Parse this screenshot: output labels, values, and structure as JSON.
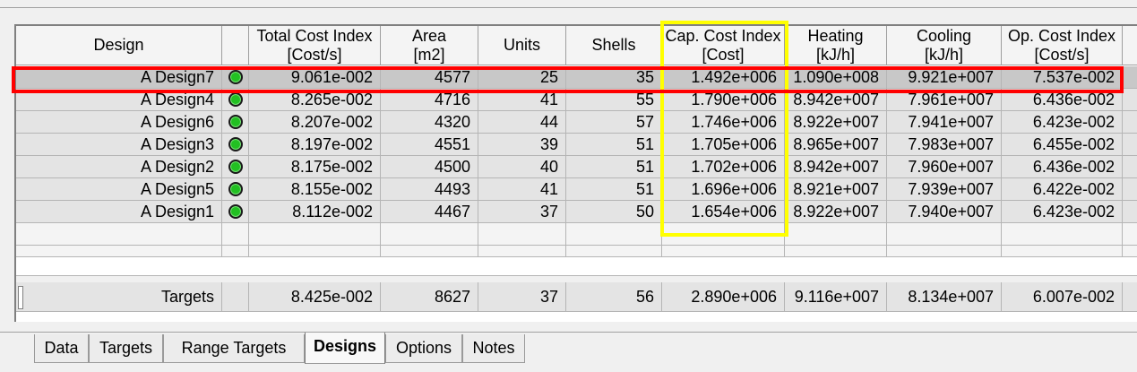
{
  "grid": {
    "headers": [
      {
        "line1": "Design",
        "line2": ""
      },
      {
        "line1": "",
        "line2": ""
      },
      {
        "line1": "Total Cost Index",
        "line2": "[Cost/s]"
      },
      {
        "line1": "Area",
        "line2": "[m2]"
      },
      {
        "line1": "Units",
        "line2": ""
      },
      {
        "line1": "Shells",
        "line2": ""
      },
      {
        "line1": "Cap. Cost Index",
        "line2": "[Cost]"
      },
      {
        "line1": "Heating",
        "line2": "[kJ/h]"
      },
      {
        "line1": "Cooling",
        "line2": "[kJ/h]"
      },
      {
        "line1": "Op. Cost Index",
        "line2": "[Cost/s]"
      }
    ],
    "rows": [
      {
        "design": "A Design7",
        "total_cost": "9.061e-002",
        "area": "4577",
        "units": "25",
        "shells": "35",
        "cap_cost": "1.492e+006",
        "heating": "1.090e+008",
        "cooling": "9.921e+007",
        "op_cost": "7.537e-002"
      },
      {
        "design": "A Design4",
        "total_cost": "8.265e-002",
        "area": "4716",
        "units": "41",
        "shells": "55",
        "cap_cost": "1.790e+006",
        "heating": "8.942e+007",
        "cooling": "7.961e+007",
        "op_cost": "6.436e-002"
      },
      {
        "design": "A Design6",
        "total_cost": "8.207e-002",
        "area": "4320",
        "units": "44",
        "shells": "57",
        "cap_cost": "1.746e+006",
        "heating": "8.922e+007",
        "cooling": "7.941e+007",
        "op_cost": "6.423e-002"
      },
      {
        "design": "A Design3",
        "total_cost": "8.197e-002",
        "area": "4551",
        "units": "39",
        "shells": "51",
        "cap_cost": "1.705e+006",
        "heating": "8.965e+007",
        "cooling": "7.983e+007",
        "op_cost": "6.455e-002"
      },
      {
        "design": "A Design2",
        "total_cost": "8.175e-002",
        "area": "4500",
        "units": "40",
        "shells": "51",
        "cap_cost": "1.702e+006",
        "heating": "8.942e+007",
        "cooling": "7.960e+007",
        "op_cost": "6.436e-002"
      },
      {
        "design": "A Design5",
        "total_cost": "8.155e-002",
        "area": "4493",
        "units": "41",
        "shells": "51",
        "cap_cost": "1.696e+006",
        "heating": "8.921e+007",
        "cooling": "7.939e+007",
        "op_cost": "6.422e-002"
      },
      {
        "design": "A Design1",
        "total_cost": "8.112e-002",
        "area": "4467",
        "units": "37",
        "shells": "50",
        "cap_cost": "1.654e+006",
        "heating": "8.922e+007",
        "cooling": "7.940e+007",
        "op_cost": "6.423e-002"
      }
    ],
    "targets": {
      "label": "Targets",
      "total_cost": "8.425e-002",
      "area": "8627",
      "units": "37",
      "shells": "56",
      "cap_cost": "2.890e+006",
      "heating": "9.116e+007",
      "cooling": "8.134e+007",
      "op_cost": "6.007e-002"
    }
  },
  "status_icon": "green-led-icon",
  "highlight_colors": {
    "selected_row_box": "#ff0000",
    "cap_cost_column_box": "#ffff00"
  },
  "tabs": [
    {
      "label": "Data",
      "active": false
    },
    {
      "label": "Targets",
      "active": false
    },
    {
      "label": "Range Targets",
      "active": false
    },
    {
      "label": "Designs",
      "active": true
    },
    {
      "label": "Options",
      "active": false
    },
    {
      "label": "Notes",
      "active": false
    }
  ]
}
